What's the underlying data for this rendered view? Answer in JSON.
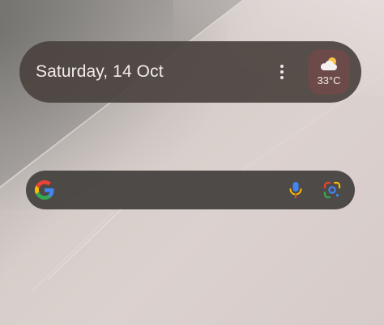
{
  "date_widget": {
    "date": "Saturday, 14 Oct",
    "weather": {
      "icon": "cloud-sun-icon",
      "temperature": "33°C"
    },
    "menu_icon": "more-vert-icon"
  },
  "search_bar": {
    "logo_icon": "google-g-icon",
    "voice_icon": "microphone-icon",
    "lens_icon": "google-lens-icon"
  },
  "colors": {
    "widget_bg": "#4a423e",
    "weather_chip_bg": "#6b4a49",
    "search_bg": "#464240",
    "google_blue": "#4285F4",
    "google_red": "#EA4335",
    "google_yellow": "#FBBC05",
    "google_green": "#34A853"
  }
}
